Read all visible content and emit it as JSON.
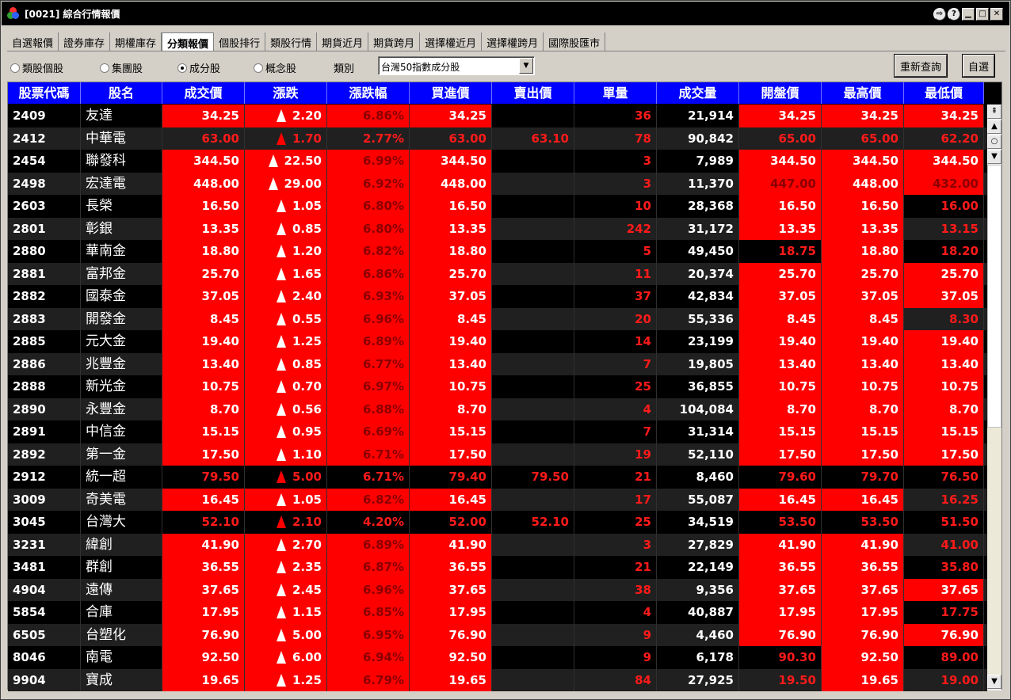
{
  "window": {
    "title": "[0021] 綜合行情報價"
  },
  "tabs": [
    "自選報價",
    "證券庫存",
    "期權庫存",
    "分類報價",
    "個股排行",
    "類股行情",
    "期貨近月",
    "期貨跨月",
    "選擇權近月",
    "選擇權跨月",
    "國際股匯市"
  ],
  "active_tab": 3,
  "filters": {
    "radios": [
      {
        "label": "類股個股",
        "selected": false
      },
      {
        "label": "集團股",
        "selected": false
      },
      {
        "label": "成分股",
        "selected": true
      },
      {
        "label": "概念股",
        "selected": false
      }
    ],
    "category_label": "類別",
    "category_value": "台灣50指數成分股",
    "refresh_button": "重新查詢",
    "custom_button": "自選"
  },
  "columns": [
    "股票代碼",
    "股名",
    "成交價",
    "漲跌",
    "漲跌幅",
    "買進價",
    "賣出價",
    "單量",
    "成交量",
    "開盤價",
    "最高價",
    "最低價"
  ],
  "rows": [
    {
      "code": "2409",
      "name": "友達",
      "price": "34.25",
      "chg": "2.20",
      "pct": "6.86%",
      "bid": "34.25",
      "ask": "",
      "qty": "36",
      "vol": "21,914",
      "open": "34.25",
      "high": "34.25",
      "low": "34.25",
      "lim": 1,
      "ol": 1,
      "hl": 1,
      "ll": 1,
      "lr": 0
    },
    {
      "code": "2412",
      "name": "中華電",
      "price": "63.00",
      "chg": "1.70",
      "pct": "2.77%",
      "bid": "63.00",
      "ask": "63.10",
      "qty": "78",
      "vol": "90,842",
      "open": "65.00",
      "high": "65.00",
      "low": "62.20",
      "lim": 0,
      "ol": 0,
      "hl": 0,
      "ll": 0,
      "lr": 0
    },
    {
      "code": "2454",
      "name": "聯發科",
      "price": "344.50",
      "chg": "22.50",
      "pct": "6.99%",
      "bid": "344.50",
      "ask": "",
      "qty": "3",
      "vol": "7,989",
      "open": "344.50",
      "high": "344.50",
      "low": "344.50",
      "lim": 1,
      "ol": 1,
      "hl": 1,
      "ll": 1,
      "lr": 0
    },
    {
      "code": "2498",
      "name": "宏達電",
      "price": "448.00",
      "chg": "29.00",
      "pct": "6.92%",
      "bid": "448.00",
      "ask": "",
      "qty": "3",
      "vol": "11,370",
      "open": "447.00",
      "high": "448.00",
      "low": "432.00",
      "lim": 1,
      "ol": 2,
      "hl": 1,
      "ll": 2,
      "lr": 0
    },
    {
      "code": "2603",
      "name": "長榮",
      "price": "16.50",
      "chg": "1.05",
      "pct": "6.80%",
      "bid": "16.50",
      "ask": "",
      "qty": "10",
      "vol": "28,368",
      "open": "16.50",
      "high": "16.50",
      "low": "16.00",
      "lim": 1,
      "ol": 1,
      "hl": 1,
      "ll": 0,
      "lr": 0
    },
    {
      "code": "2801",
      "name": "彰銀",
      "price": "13.35",
      "chg": "0.85",
      "pct": "6.80%",
      "bid": "13.35",
      "ask": "",
      "qty": "242",
      "vol": "31,172",
      "open": "13.35",
      "high": "13.35",
      "low": "13.15",
      "lim": 1,
      "ol": 1,
      "hl": 1,
      "ll": 0,
      "lr": 0
    },
    {
      "code": "2880",
      "name": "華南金",
      "price": "18.80",
      "chg": "1.20",
      "pct": "6.82%",
      "bid": "18.80",
      "ask": "",
      "qty": "5",
      "vol": "49,450",
      "open": "18.75",
      "high": "18.80",
      "low": "18.20",
      "lim": 1,
      "ol": 0,
      "hl": 1,
      "ll": 0,
      "lr": 0
    },
    {
      "code": "2881",
      "name": "富邦金",
      "price": "25.70",
      "chg": "1.65",
      "pct": "6.86%",
      "bid": "25.70",
      "ask": "",
      "qty": "11",
      "vol": "20,374",
      "open": "25.70",
      "high": "25.70",
      "low": "25.70",
      "lim": 1,
      "ol": 1,
      "hl": 1,
      "ll": 1,
      "lr": 0
    },
    {
      "code": "2882",
      "name": "國泰金",
      "price": "37.05",
      "chg": "2.40",
      "pct": "6.93%",
      "bid": "37.05",
      "ask": "",
      "qty": "37",
      "vol": "42,834",
      "open": "37.05",
      "high": "37.05",
      "low": "37.05",
      "lim": 1,
      "ol": 1,
      "hl": 1,
      "ll": 1,
      "lr": 0
    },
    {
      "code": "2883",
      "name": "開發金",
      "price": "8.45",
      "chg": "0.55",
      "pct": "6.96%",
      "bid": "8.45",
      "ask": "",
      "qty": "20",
      "vol": "55,336",
      "open": "8.45",
      "high": "8.45",
      "low": "8.30",
      "lim": 1,
      "ol": 1,
      "hl": 1,
      "ll": 0,
      "lr": 0
    },
    {
      "code": "2885",
      "name": "元大金",
      "price": "19.40",
      "chg": "1.25",
      "pct": "6.89%",
      "bid": "19.40",
      "ask": "",
      "qty": "14",
      "vol": "23,199",
      "open": "19.40",
      "high": "19.40",
      "low": "19.40",
      "lim": 1,
      "ol": 1,
      "hl": 1,
      "ll": 1,
      "lr": 0
    },
    {
      "code": "2886",
      "name": "兆豐金",
      "price": "13.40",
      "chg": "0.85",
      "pct": "6.77%",
      "bid": "13.40",
      "ask": "",
      "qty": "7",
      "vol": "19,805",
      "open": "13.40",
      "high": "13.40",
      "low": "13.40",
      "lim": 1,
      "ol": 1,
      "hl": 1,
      "ll": 1,
      "lr": 0
    },
    {
      "code": "2888",
      "name": "新光金",
      "price": "10.75",
      "chg": "0.70",
      "pct": "6.97%",
      "bid": "10.75",
      "ask": "",
      "qty": "25",
      "vol": "36,855",
      "open": "10.75",
      "high": "10.75",
      "low": "10.75",
      "lim": 1,
      "ol": 1,
      "hl": 1,
      "ll": 1,
      "lr": 0
    },
    {
      "code": "2890",
      "name": "永豐金",
      "price": "8.70",
      "chg": "0.56",
      "pct": "6.88%",
      "bid": "8.70",
      "ask": "",
      "qty": "4",
      "vol": "104,084",
      "open": "8.70",
      "high": "8.70",
      "low": "8.70",
      "lim": 1,
      "ol": 1,
      "hl": 1,
      "ll": 1,
      "lr": 0
    },
    {
      "code": "2891",
      "name": "中信金",
      "price": "15.15",
      "chg": "0.95",
      "pct": "6.69%",
      "bid": "15.15",
      "ask": "",
      "qty": "7",
      "vol": "31,314",
      "open": "15.15",
      "high": "15.15",
      "low": "15.15",
      "lim": 1,
      "ol": 1,
      "hl": 1,
      "ll": 1,
      "lr": 0
    },
    {
      "code": "2892",
      "name": "第一金",
      "price": "17.50",
      "chg": "1.10",
      "pct": "6.71%",
      "bid": "17.50",
      "ask": "",
      "qty": "19",
      "vol": "52,110",
      "open": "17.50",
      "high": "17.50",
      "low": "17.50",
      "lim": 1,
      "ol": 1,
      "hl": 1,
      "ll": 1,
      "lr": 0
    },
    {
      "code": "2912",
      "name": "統一超",
      "price": "79.50",
      "chg": "5.00",
      "pct": "6.71%",
      "bid": "79.40",
      "ask": "79.50",
      "qty": "21",
      "vol": "8,460",
      "open": "79.60",
      "high": "79.70",
      "low": "76.50",
      "lim": 0,
      "ol": 0,
      "hl": 0,
      "ll": 0,
      "lr": 0
    },
    {
      "code": "3009",
      "name": "奇美電",
      "price": "16.45",
      "chg": "1.05",
      "pct": "6.82%",
      "bid": "16.45",
      "ask": "",
      "qty": "17",
      "vol": "55,087",
      "open": "16.45",
      "high": "16.45",
      "low": "16.25",
      "lim": 1,
      "ol": 1,
      "hl": 1,
      "ll": 0,
      "lr": 0
    },
    {
      "code": "3045",
      "name": "台灣大",
      "price": "52.10",
      "chg": "2.10",
      "pct": "4.20%",
      "bid": "52.00",
      "ask": "52.10",
      "qty": "25",
      "vol": "34,519",
      "open": "53.50",
      "high": "53.50",
      "low": "51.50",
      "lim": 0,
      "ol": 0,
      "hl": 0,
      "ll": 0,
      "lr": 0
    },
    {
      "code": "3231",
      "name": "緯創",
      "price": "41.90",
      "chg": "2.70",
      "pct": "6.89%",
      "bid": "41.90",
      "ask": "",
      "qty": "3",
      "vol": "27,829",
      "open": "41.90",
      "high": "41.90",
      "low": "41.00",
      "lim": 1,
      "ol": 1,
      "hl": 1,
      "ll": 0,
      "lr": 0
    },
    {
      "code": "3481",
      "name": "群創",
      "price": "36.55",
      "chg": "2.35",
      "pct": "6.87%",
      "bid": "36.55",
      "ask": "",
      "qty": "21",
      "vol": "22,149",
      "open": "36.55",
      "high": "36.55",
      "low": "35.80",
      "lim": 1,
      "ol": 1,
      "hl": 1,
      "ll": 0,
      "lr": 0
    },
    {
      "code": "4904",
      "name": "遠傳",
      "price": "37.65",
      "chg": "2.45",
      "pct": "6.96%",
      "bid": "37.65",
      "ask": "",
      "qty": "38",
      "vol": "9,356",
      "open": "37.65",
      "high": "37.65",
      "low": "37.65",
      "lim": 1,
      "ol": 1,
      "hl": 1,
      "ll": 1,
      "lr": 0
    },
    {
      "code": "5854",
      "name": "合庫",
      "price": "17.95",
      "chg": "1.15",
      "pct": "6.85%",
      "bid": "17.95",
      "ask": "",
      "qty": "4",
      "vol": "40,887",
      "open": "17.95",
      "high": "17.95",
      "low": "17.75",
      "lim": 1,
      "ol": 1,
      "hl": 1,
      "ll": 0,
      "lr": 0
    },
    {
      "code": "6505",
      "name": "台塑化",
      "price": "76.90",
      "chg": "5.00",
      "pct": "6.95%",
      "bid": "76.90",
      "ask": "",
      "qty": "9",
      "vol": "4,460",
      "open": "76.90",
      "high": "76.90",
      "low": "76.90",
      "lim": 1,
      "ol": 1,
      "hl": 1,
      "ll": 1,
      "lr": 0
    },
    {
      "code": "8046",
      "name": "南電",
      "price": "92.50",
      "chg": "6.00",
      "pct": "6.94%",
      "bid": "92.50",
      "ask": "",
      "qty": "9",
      "vol": "6,178",
      "open": "90.30",
      "high": "92.50",
      "low": "89.00",
      "lim": 1,
      "ol": 0,
      "hl": 1,
      "ll": 0,
      "lr": 0
    },
    {
      "code": "9904",
      "name": "寶成",
      "price": "19.65",
      "chg": "1.25",
      "pct": "6.79%",
      "bid": "19.65",
      "ask": "",
      "qty": "84",
      "vol": "27,925",
      "open": "19.50",
      "high": "19.65",
      "low": "19.00",
      "lim": 1,
      "ol": 0,
      "hl": 1,
      "ll": 0,
      "lr": 0
    }
  ],
  "colors": {
    "header_bg": "#0000ff",
    "limit_up_bg": "#ff0000",
    "up_text": "#ff1a1a",
    "row_bg": "#000000",
    "row_alt_bg": "#202020"
  }
}
